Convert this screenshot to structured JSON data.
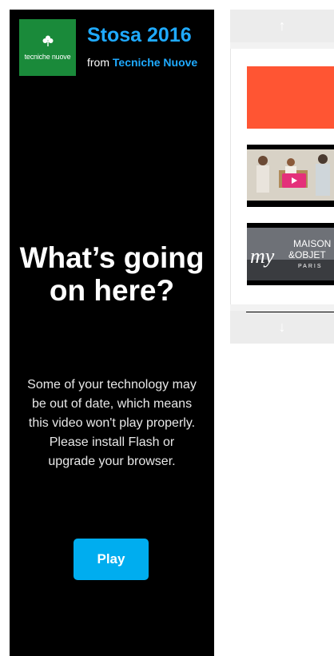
{
  "video": {
    "title": "Stosa 2016",
    "byline_prefix": "from",
    "owner": "Tecniche Nuove",
    "logo_text": "tecniche nuove"
  },
  "error": {
    "headline": "What’s going on here?",
    "message": "Some of your technology may be out of date, which means this video won't play properly. Please install Flash or upgrade your browser.",
    "play_label": "Play"
  },
  "sidebar": {
    "up_icon": "↑",
    "down_icon": "↓",
    "thumbnails": [
      {
        "name": "thumbnail-1",
        "color": "#ff5533"
      },
      {
        "name": "thumbnail-2",
        "color": "#000000"
      },
      {
        "name": "thumbnail-3",
        "color": "#000000"
      }
    ],
    "thumb3_text_top": "MAISON",
    "thumb3_text_amp": "&OBJET",
    "thumb3_text_city": "PARIS",
    "thumb3_script": "my"
  },
  "colors": {
    "accent": "#1faaff",
    "button": "#00adef",
    "logo_bg": "#1a8a3a",
    "player_bg": "#000000"
  }
}
